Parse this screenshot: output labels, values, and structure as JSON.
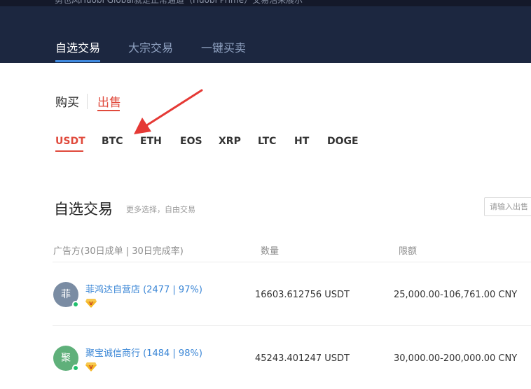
{
  "top_notice": "勇也风Huobi Global就是正常通道（Huobi Prime）交易活来展示",
  "tabs": [
    "自选交易",
    "大宗交易",
    "一键买卖"
  ],
  "buy_label": "购买",
  "sell_label": "出售",
  "coins": [
    "USDT",
    "BTC",
    "ETH",
    "EOS",
    "XRP",
    "LTC",
    "HT",
    "DOGE"
  ],
  "active_coin": "USDT",
  "section": {
    "title": "自选交易",
    "subtitle": "更多选择，自由交易"
  },
  "search_placeholder": "请输入出售",
  "table": {
    "headers": [
      "广告方(30日成单 | 30日完成率)",
      "数量",
      "限额"
    ],
    "rows": [
      {
        "avatar": "菲",
        "avatar_color": "#7a8ca3",
        "merchant": "菲鸿达自营店 (2477 | 97%)",
        "amount": "16603.612756 USDT",
        "limit": "25,000.00-106,761.00 CNY",
        "badge_icon": "diamond-v-icon"
      },
      {
        "avatar": "聚",
        "avatar_color": "#5fb07a",
        "merchant": "聚宝诚信商行 (1484 | 98%)",
        "amount": "45243.401247 USDT",
        "limit": "30,000.00-200,000.00 CNY",
        "badge_icon": "diamond-v-icon"
      }
    ]
  },
  "colors": {
    "header_bg": "#1c2740",
    "accent_red": "#e04a3c",
    "accent_blue": "#3f8ae0",
    "link_blue": "#3a86d6",
    "online_green": "#1fbf6c"
  }
}
